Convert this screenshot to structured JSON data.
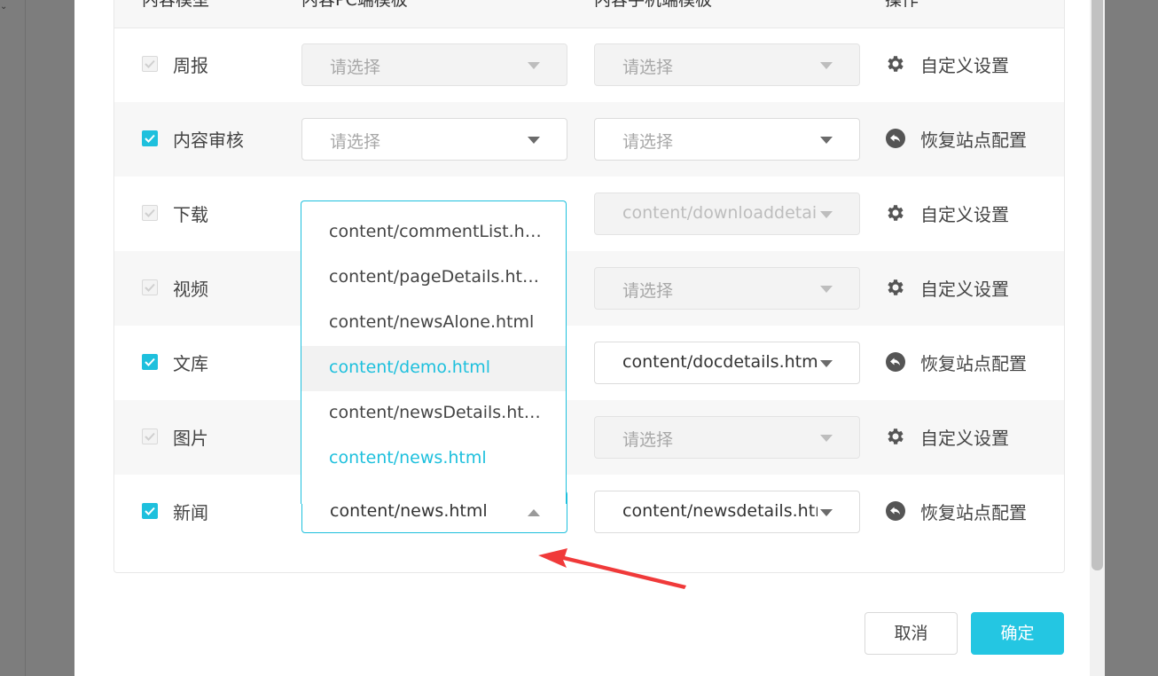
{
  "colors": {
    "accent": "#1ec0dd",
    "annotation_arrow": "#f03a3a"
  },
  "table": {
    "headers": {
      "module": "内容模型",
      "pc_template": "内容PC端模板",
      "mobile_template": "内容手机端模板",
      "action": "操作"
    },
    "rows": [
      {
        "name": "周报",
        "checked": false,
        "pc": "请选择",
        "pc_placeholder": true,
        "pc_disabled": true,
        "mobile": "请选择",
        "mobile_placeholder": true,
        "mobile_disabled": true,
        "action": "自定义设置",
        "action_icon": "gear-icon"
      },
      {
        "name": "内容审核",
        "checked": true,
        "pc": "请选择",
        "pc_placeholder": true,
        "pc_disabled": false,
        "mobile": "请选择",
        "mobile_placeholder": true,
        "mobile_disabled": false,
        "action": "恢复站点配置",
        "action_icon": "undo-icon"
      },
      {
        "name": "下载",
        "checked": false,
        "pc": "",
        "mobile": "content/downloaddetail",
        "mobile_placeholder": false,
        "mobile_disabled": true,
        "action": "自定义设置",
        "action_icon": "gear-icon"
      },
      {
        "name": "视频",
        "checked": false,
        "pc": "",
        "mobile": "请选择",
        "mobile_placeholder": true,
        "mobile_disabled": true,
        "action": "自定义设置",
        "action_icon": "gear-icon"
      },
      {
        "name": "文库",
        "checked": true,
        "pc": "",
        "mobile": "content/docdetails.html",
        "mobile_placeholder": false,
        "mobile_disabled": false,
        "action": "恢复站点配置",
        "action_icon": "undo-icon"
      },
      {
        "name": "图片",
        "checked": false,
        "pc": "",
        "mobile": "请选择",
        "mobile_placeholder": true,
        "mobile_disabled": true,
        "action": "自定义设置",
        "action_icon": "gear-icon"
      },
      {
        "name": "新闻",
        "checked": true,
        "pc": "content/news.html",
        "pc_placeholder": false,
        "pc_disabled": false,
        "mobile": "content/newsdetails.html",
        "mobile_placeholder": false,
        "mobile_disabled": false,
        "action": "恢复站点配置",
        "action_icon": "undo-icon"
      }
    ]
  },
  "dropdown": {
    "options": [
      {
        "label": "content/commentList.html",
        "state": "normal"
      },
      {
        "label": "content/pageDetails.html",
        "state": "normal"
      },
      {
        "label": "content/newsAlone.html",
        "state": "normal"
      },
      {
        "label": "content/demo.html",
        "state": "hover"
      },
      {
        "label": "content/newsDetails.html",
        "state": "normal"
      },
      {
        "label": "content/news.html",
        "state": "selected"
      }
    ]
  },
  "footer": {
    "cancel": "取消",
    "confirm": "确定"
  }
}
